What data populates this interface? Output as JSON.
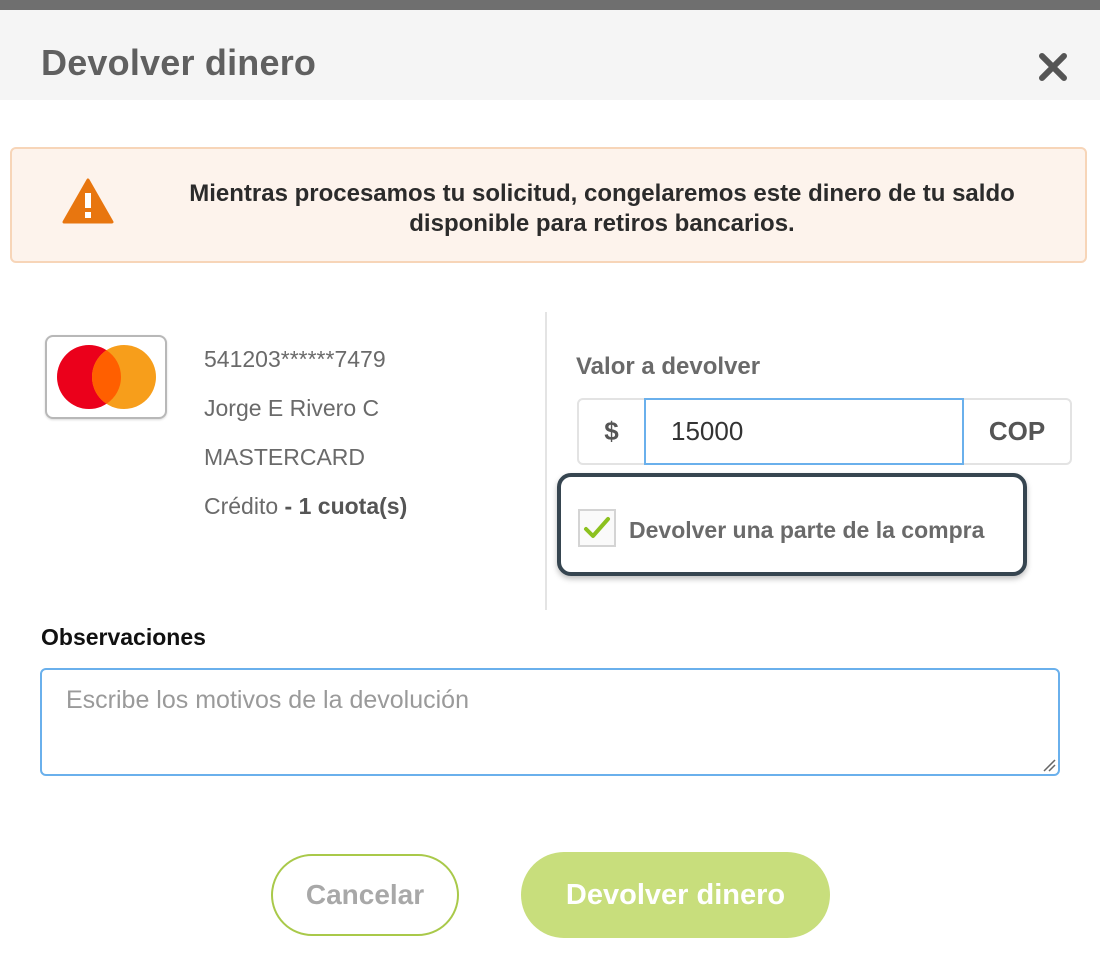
{
  "dialog": {
    "title": "Devolver dinero"
  },
  "alert": {
    "message": "Mientras procesamos tu solicitud, congelaremos este dinero de tu saldo disponible para retiros bancarios."
  },
  "card": {
    "brand_icon": "mastercard-logo",
    "number": "541203******7479",
    "holder": "Jorge E Rivero C",
    "brand": "MASTERCARD",
    "type": "Crédito",
    "installments": "- 1 cuota(s)"
  },
  "refund": {
    "label": "Valor a devolver",
    "currency_symbol": "$",
    "amount": "15000",
    "currency": "COP",
    "partial_label": "Devolver una parte de la compra",
    "partial_checked": true
  },
  "observations": {
    "label": "Observaciones",
    "placeholder": "Escribe los motivos de la devolución",
    "value": ""
  },
  "actions": {
    "cancel_label": "Cancelar",
    "submit_label": "Devolver dinero"
  },
  "colors": {
    "accent_green": "#c8de7c",
    "focus_blue": "#6ab0ec",
    "warning_orange": "#e8760f"
  }
}
